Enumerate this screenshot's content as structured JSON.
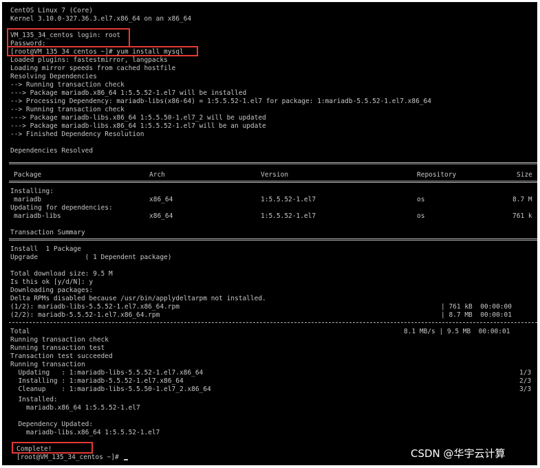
{
  "terminal": {
    "banner": [
      "CentOS Linux 7 (Core)",
      "Kernel 3.10.0-327.36.3.el7.x86_64 on an x86_64"
    ],
    "login_prompt": "VM_135_34_centos login: root",
    "password_prompt": "Password:",
    "command_line": "[root@VM_135_34_centos ~]# yum install mysql",
    "output_lines": [
      "Loaded plugins: fastestmirror, langpacks",
      "Loading mirror speeds from cached hostfile",
      "Resolving Dependencies",
      "--> Running transaction check",
      "---> Package mariadb.x86_64 1:5.5.52-1.el7 will be installed",
      "--> Processing Dependency: mariadb-libs(x86-64) = 1:5.5.52-1.el7 for package: 1:mariadb-5.5.52-1.el7.x86_64",
      "--> Running transaction check",
      "---> Package mariadb-libs.x86_64 1:5.5.50-1.el7_2 will be updated",
      "---> Package mariadb-libs.x86_64 1:5.5.52-1.el7 will be an update",
      "--> Finished Dependency Resolution"
    ],
    "deps_resolved": "Dependencies Resolved",
    "table": {
      "headers": [
        "Package",
        "Arch",
        "Version",
        "Repository",
        "Size"
      ],
      "installing_label": "Installing:",
      "installing_rows": [
        [
          "mariadb",
          "x86_64",
          "1:5.5.52-1.el7",
          "os",
          "8.7 M"
        ]
      ],
      "updating_label": "Updating for dependencies:",
      "updating_rows": [
        [
          "mariadb-libs",
          "x86_64",
          "1:5.5.52-1.el7",
          "os",
          "761 k"
        ]
      ]
    },
    "transaction_summary": "Transaction Summary",
    "install_line": "Install  1 Package",
    "upgrade_line": "Upgrade            ( 1 Dependent package)",
    "download_block": [
      "Total download size: 9.5 M",
      "Is this ok [y/d/N]: y",
      "Downloading packages:",
      "Delta RPMs disabled because /usr/bin/applydeltarpm not installed."
    ],
    "downloads": [
      {
        "name": "(1/2): mariadb-libs-5.5.52-1.el7.x86_64.rpm",
        "stats": "| 761 kB  00:00:00"
      },
      {
        "name": "(2/2): mariadb-5.5.52-1.el7.x86_64.rpm",
        "stats": "| 8.7 MB  00:00:01"
      }
    ],
    "total_label": "Total",
    "total_stats": "8.1 MB/s | 9.5 MB  00:00:01",
    "run_lines": [
      "Running transaction check",
      "Running transaction test",
      "Transaction test succeeded",
      "Running transaction"
    ],
    "steps": [
      {
        "action": "  Updating   : 1:mariadb-libs-5.5.52-1.el7.x86_64",
        "count": "1/3"
      },
      {
        "action": "  Installing : 1:mariadb-5.5.52-1.el7.x86_64",
        "count": "2/3"
      },
      {
        "action": "  Cleanup    : 1:mariadb-libs-5.5.50-1.el7_2.x86_64",
        "count": "3/3"
      }
    ],
    "installed_label": "  Installed:",
    "installed_pkg": "    mariadb.x86_64 1:5.5.52-1.el7",
    "dep_updated_label": "  Dependency Updated:",
    "dep_updated_pkg": "    mariadb-libs.x86_64 1:5.5.52-1.el7",
    "complete": "Complete!",
    "final_prompt": "[root@VM_135_34_centos ~]# "
  },
  "watermark": "CSDN @华宇云计算",
  "colors": {
    "background": "#000000",
    "text": "#c8c8c8",
    "highlight": "#e53935"
  }
}
